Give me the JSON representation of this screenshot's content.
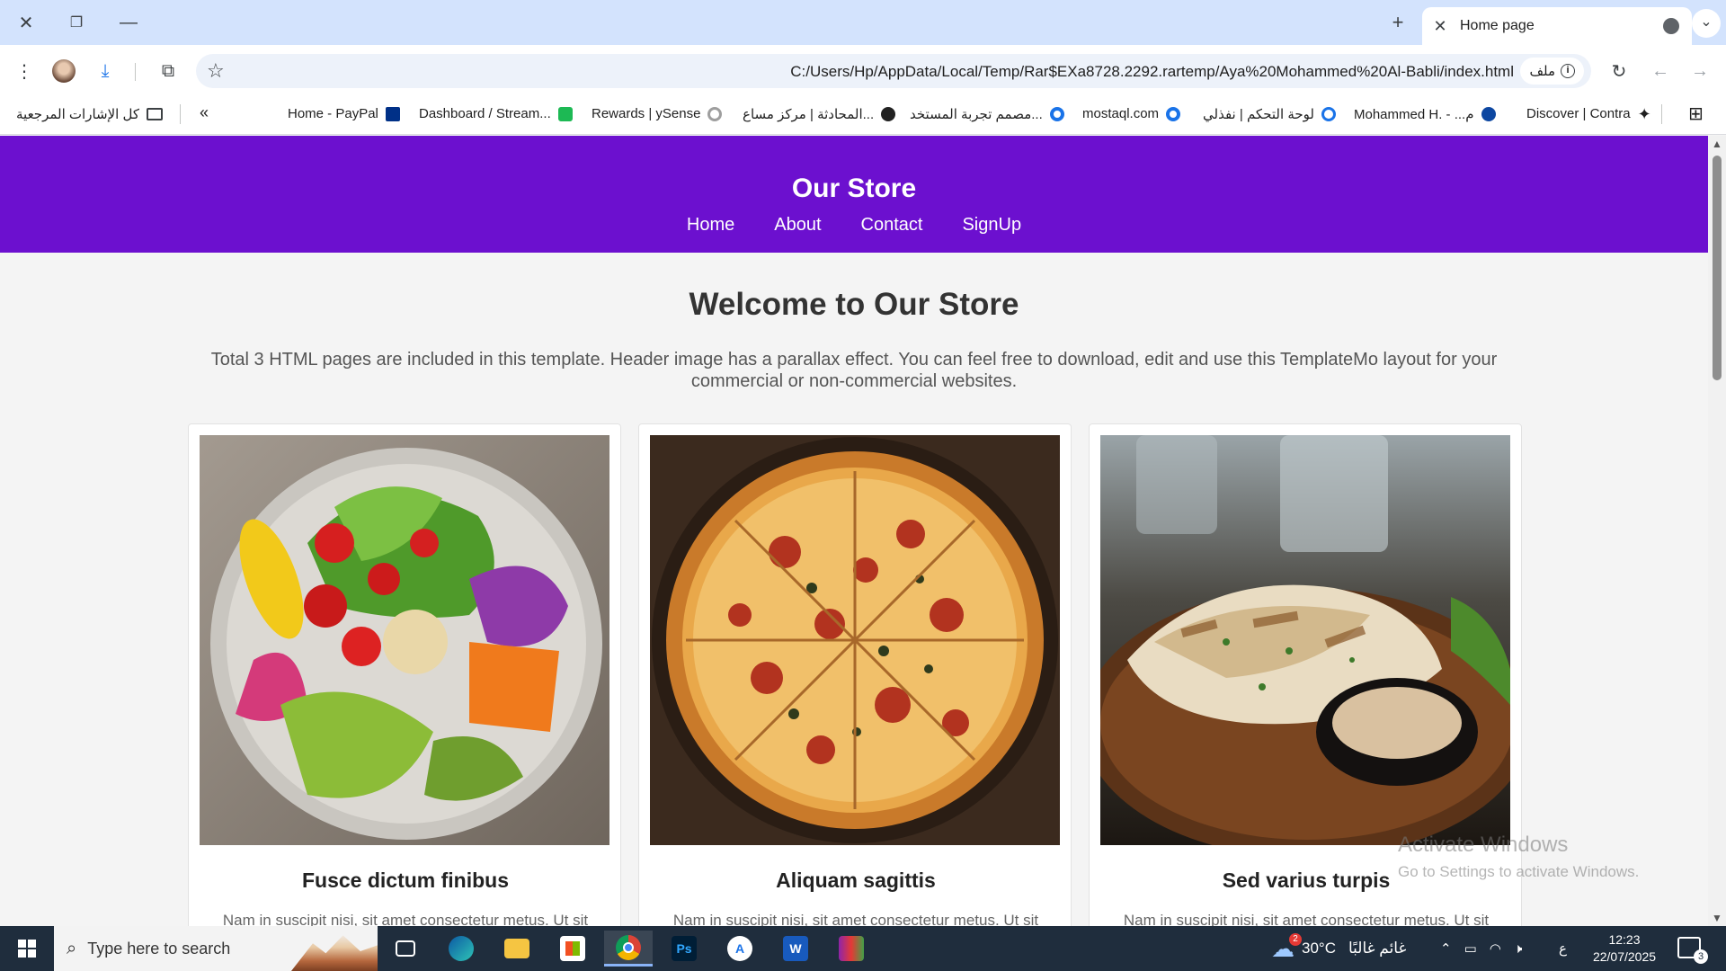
{
  "browser": {
    "tab_title": "Home page",
    "address_url": "C:/Users/Hp/AppData/Local/Temp/Rar$EXa8728.2292.rartemp/Aya%20Mohammed%20Al-Babli/index.html",
    "address_chip": "ملف",
    "bookmarks_left": "كل الإشارات المرجعية",
    "bookmarks_overflow": "«",
    "bookmarks": [
      {
        "label": "Home - PayPal",
        "color": "#003087"
      },
      {
        "label": "Dashboard / Stream...",
        "color": "#1db954"
      },
      {
        "label": "Rewards | ySense",
        "color": "#9e9e9e"
      },
      {
        "label": "المحادثة | مركز مساع...",
        "color": "#222222"
      },
      {
        "label": "مصمم تجربة المستخد...",
        "color": "#1a73e8"
      },
      {
        "label": "mostaql.com",
        "color": "#1a73e8"
      },
      {
        "label": "لوحة التحكم | نفذلي",
        "color": "#1a73e8"
      },
      {
        "label": "Mohammed H. - ...م",
        "color": "#0d47a1"
      },
      {
        "label": "Discover | Contra",
        "color": "#222222"
      }
    ]
  },
  "site": {
    "title": "Our Store",
    "nav": [
      "Home",
      "About",
      "Contact",
      "SignUp"
    ],
    "welcome": "Welcome to Our Store",
    "intro": "Total 3 HTML pages are included in this template. Header image has a parallax effect. You can feel free to download, edit and use this TemplateMo layout for your commercial or non-commercial websites.",
    "cards": [
      {
        "title": "Fusce dictum finibus",
        "text": "Nam in suscipit nisi, sit amet consectetur metus. Ut sit"
      },
      {
        "title": "Aliquam sagittis",
        "text": "Nam in suscipit nisi, sit amet consectetur metus. Ut sit"
      },
      {
        "title": "Sed varius turpis",
        "text": "Nam in suscipit nisi, sit amet consectetur metus. Ut sit"
      }
    ]
  },
  "overlay": {
    "activate_line1": "Activate Windows",
    "activate_line2": "Go to Settings to activate Windows."
  },
  "taskbar": {
    "search_placeholder": "Type here to search",
    "weather_badge": "2",
    "weather_temp": "30°C",
    "weather_text": "غائم غالبًا",
    "lang": "ع",
    "time": "12:23",
    "date": "22/07/2025",
    "notifications": "3",
    "apps": [
      "Ps",
      "W"
    ]
  },
  "colors": {
    "header_purple": "#6c10cf",
    "tab_strip": "#d3e3fd",
    "taskbar": "#1f2d3d"
  }
}
